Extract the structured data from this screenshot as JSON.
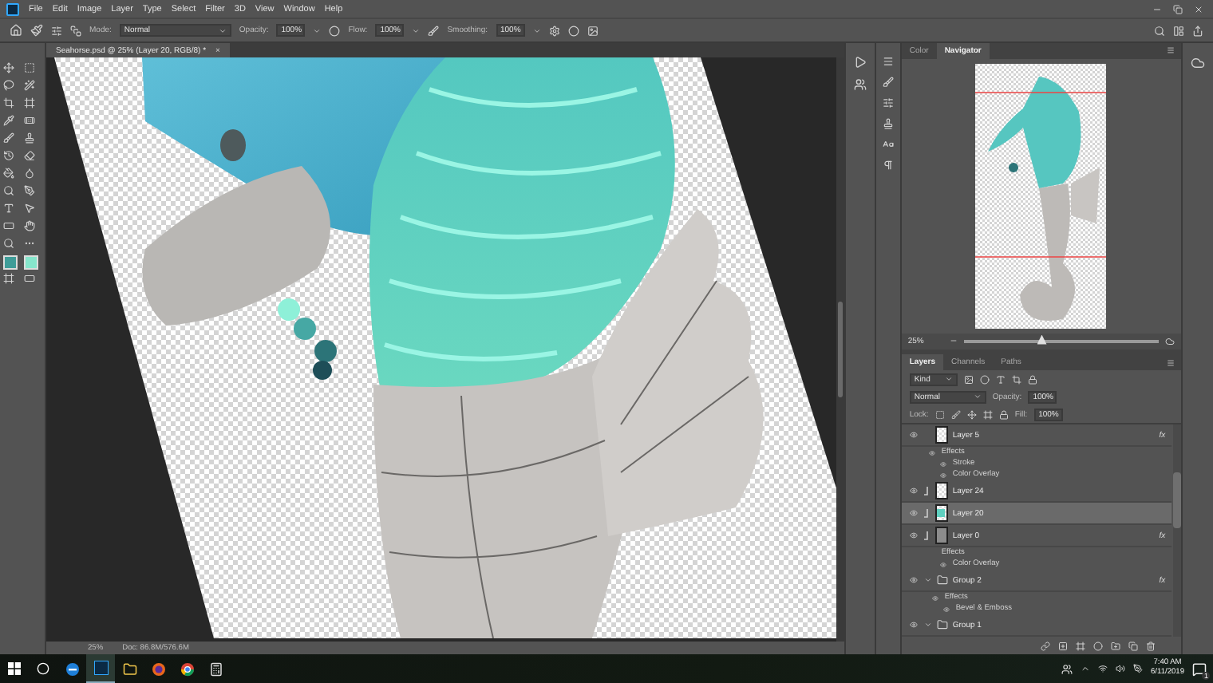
{
  "menu": [
    "File",
    "Edit",
    "Image",
    "Layer",
    "Type",
    "Select",
    "Filter",
    "3D",
    "View",
    "Window",
    "Help"
  ],
  "options": {
    "mode_label": "Mode:",
    "mode": "Normal",
    "opacity_label": "Opacity:",
    "opacity": "100%",
    "flow_label": "Flow:",
    "flow": "100%",
    "smoothing_label": "Smoothing:",
    "smoothing": "100%"
  },
  "document_tab": {
    "title": "Seahorse.psd @ 25% (Layer 20, RGB/8) *",
    "close": "×"
  },
  "status_bar": {
    "zoom": "25%",
    "doc": "Doc: 86.8M/576.6M"
  },
  "navigator": {
    "tabs": [
      {
        "label": "Color",
        "selected": false
      },
      {
        "label": "Navigator",
        "selected": true
      }
    ],
    "zoom": "25%",
    "level": 0.4
  },
  "layers": {
    "tabs": [
      {
        "label": "Layers",
        "selected": true
      },
      {
        "label": "Channels",
        "selected": false
      },
      {
        "label": "Paths",
        "selected": false
      }
    ],
    "filter": "Kind",
    "blend_mode": "Normal",
    "opacity_label": "Opacity:",
    "opacity": "100%",
    "lock_label": "Lock:",
    "fill_label": "Fill:",
    "fill": "100%",
    "items": [
      {
        "kind": "layer",
        "name": "Layer 5",
        "visible": true,
        "selected": false,
        "clipped": false,
        "thumbnail": {
          "kind": "checker"
        },
        "badge": "fx",
        "effects": {
          "label": "Effects",
          "visible": true,
          "items": [
            {
              "label": "Stroke",
              "visible": true
            },
            {
              "label": "Color Overlay",
              "visible": true
            }
          ]
        }
      },
      {
        "kind": "layer",
        "name": "Layer 24",
        "visible": true,
        "selected": false,
        "clipped": true,
        "thumbnail": {
          "kind": "checker"
        }
      },
      {
        "kind": "layer",
        "name": "Layer 20",
        "visible": true,
        "selected": true,
        "clipped": true,
        "thumbnail": {
          "kind": "teal"
        }
      },
      {
        "kind": "layer",
        "name": "Layer 0",
        "visible": true,
        "selected": false,
        "clipped": true,
        "thumbnail": {
          "kind": "gray"
        },
        "badge": "fx",
        "effects": {
          "label": "Effects",
          "visible": false,
          "items": [
            {
              "label": "Color Overlay",
              "visible": true
            }
          ]
        }
      },
      {
        "kind": "group",
        "name": "Group 2",
        "visible": true,
        "selected": false,
        "expanded": true,
        "badge": "fx",
        "effects": {
          "label": "Effects",
          "visible": true,
          "items": [
            {
              "label": "Bevel & Emboss",
              "visible": true
            }
          ]
        }
      },
      {
        "kind": "group",
        "name": "Group 1",
        "visible": true,
        "selected": false,
        "expanded": true
      }
    ]
  },
  "taskbar": {
    "time": "7:40 AM",
    "date": "6/11/2019",
    "notifications": "1"
  }
}
